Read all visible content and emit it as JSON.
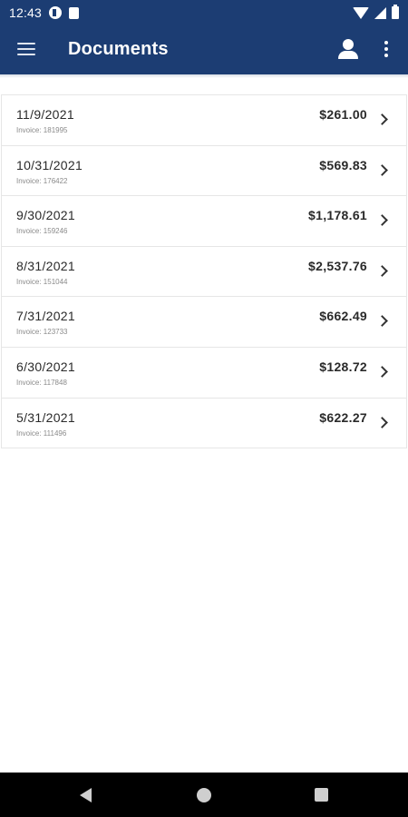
{
  "status_bar": {
    "time": "12:43"
  },
  "app_bar": {
    "title": "Documents"
  },
  "documents": [
    {
      "date": "11/9/2021",
      "invoice": "Invoice: 181995",
      "amount": "$261.00"
    },
    {
      "date": "10/31/2021",
      "invoice": "Invoice: 176422",
      "amount": "$569.83"
    },
    {
      "date": "9/30/2021",
      "invoice": "Invoice: 159246",
      "amount": "$1,178.61"
    },
    {
      "date": "8/31/2021",
      "invoice": "Invoice: 151044",
      "amount": "$2,537.76"
    },
    {
      "date": "7/31/2021",
      "invoice": "Invoice: 123733",
      "amount": "$662.49"
    },
    {
      "date": "6/30/2021",
      "invoice": "Invoice: 117848",
      "amount": "$128.72"
    },
    {
      "date": "5/31/2021",
      "invoice": "Invoice: 111496",
      "amount": "$622.27"
    }
  ],
  "colors": {
    "app_bar": "#1c3d73",
    "nav_bar": "#000000"
  },
  "icons": {
    "menu": "menu-icon",
    "profile": "profile-icon",
    "more": "more-vert-icon",
    "chevron": "chevron-right-icon",
    "nav_back": "back-icon",
    "nav_home": "home-icon",
    "nav_recents": "recents-icon"
  }
}
